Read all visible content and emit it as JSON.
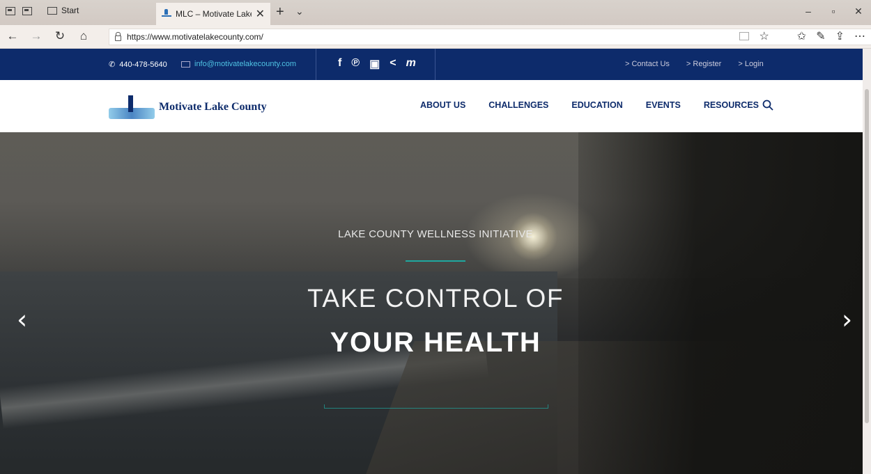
{
  "browser": {
    "tab_start_label": "Start",
    "tab_active_title": "MLC – Motivate Lake Cc",
    "url": "https://www.motivatelakecounty.com/"
  },
  "topbar": {
    "phone": "440-478-5640",
    "email": "info@motivatelakecounty.com",
    "social_icons": [
      "facebook-icon",
      "pinterest-icon",
      "youtube-icon",
      "share-icon",
      "meetup-icon"
    ],
    "links": [
      "> Contact Us",
      "> Register",
      "> Login"
    ]
  },
  "header": {
    "brand": "Motivate Lake County",
    "nav": [
      "ABOUT US",
      "CHALLENGES",
      "EDUCATION",
      "EVENTS",
      "RESOURCES"
    ]
  },
  "hero": {
    "kicker": "LAKE COUNTY WELLNESS INITIATIVE",
    "headline_1": "TAKE CONTROL OF",
    "headline_2": "YOUR HEALTH"
  },
  "colors": {
    "topbar_bg": "#0d2b6b",
    "brand_navy": "#0d2b6b",
    "accent_teal": "#1fa8a0",
    "email_link": "#4fc3e3"
  }
}
